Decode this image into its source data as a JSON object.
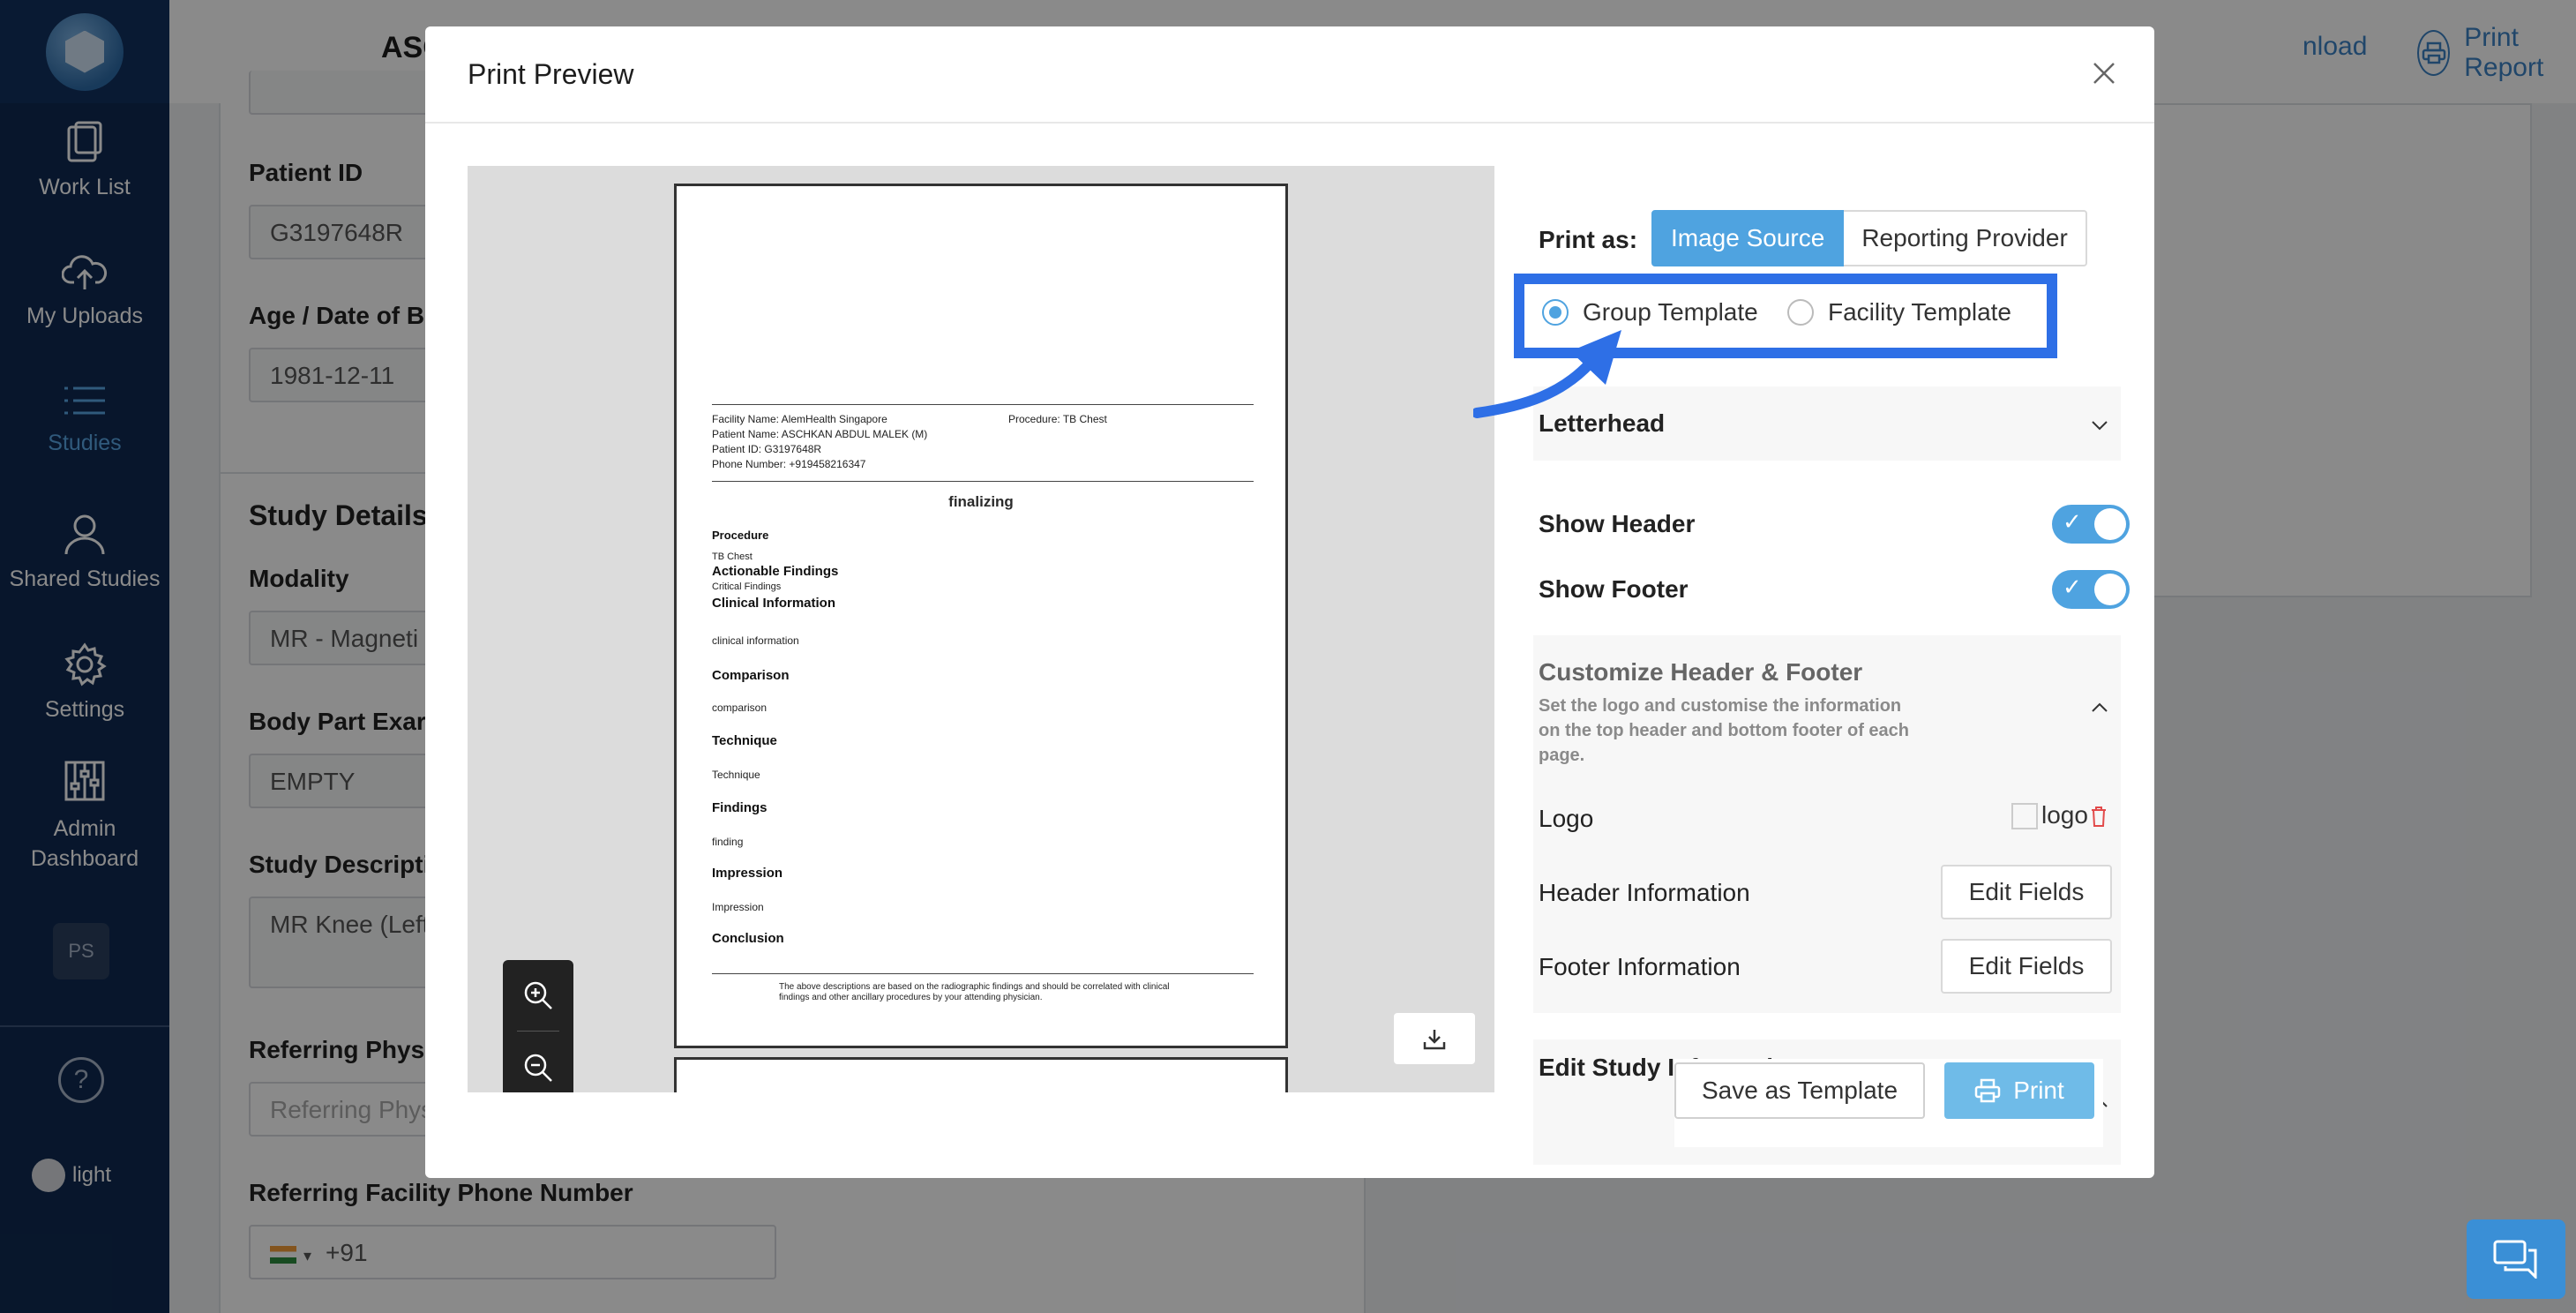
{
  "sidebar": {
    "items": [
      {
        "label": "Work List",
        "icon": "clipboard-icon"
      },
      {
        "label": "My Uploads",
        "icon": "cloud-upload-icon"
      },
      {
        "label": "Studies",
        "icon": "list-icon"
      },
      {
        "label": "Shared Studies",
        "icon": "user-icon"
      },
      {
        "label": "Settings",
        "icon": "gear-icon"
      },
      {
        "label": "Admin Dashboard",
        "icon": "sliders-icon"
      }
    ],
    "user_initials": "PS",
    "theme_label": "light"
  },
  "header": {
    "patient_name": "ASCHKAN ABDU",
    "download_label": "nload",
    "print_report_label": "Print Report"
  },
  "form": {
    "patient_id_label": "Patient ID",
    "patient_id_value": "G3197648R",
    "age_label": "Age / Date of B",
    "age_value": "1981-12-11",
    "study_details_title": "Study Details",
    "modality_label": "Modality",
    "modality_value": "MR - Magneti",
    "body_part_label": "Body Part Exar",
    "body_part_value": "EMPTY",
    "study_desc_label": "Study Descripti",
    "study_desc_value": "MR Knee (Left",
    "referring_phys_label": "Referring Physi",
    "referring_phys_placeholder": "Referring Phys",
    "ref_facility_phone_label": "Referring Facility Phone Number",
    "phone_code": "+91"
  },
  "modal": {
    "title": "Print Preview",
    "preview": {
      "facility_name": "Facility Name: AlemHealth Singapore",
      "procedure_meta": "Procedure: TB Chest",
      "patient_name": "Patient Name: ASCHKAN ABDUL MALEK (M)",
      "patient_id": "Patient ID: G3197648R",
      "phone": "Phone Number: +919458216347",
      "doc_title": "finalizing",
      "procedure_heading": "Procedure",
      "procedure_text": "TB Chest",
      "actionable_heading": "Actionable Findings",
      "actionable_text": "Critical Findings",
      "clinical_heading": "Clinical Information",
      "clinical_text": "clinical information",
      "comparison_heading": "Comparison",
      "comparison_text": "comparison",
      "technique_heading": "Technique",
      "technique_text": "Technique",
      "findings_heading": "Findings",
      "findings_text": "finding",
      "impression_heading": "Impression",
      "impression_text": "Impression",
      "conclusion_heading": "Conclusion",
      "footer_text": "The above descriptions are based on the radiographic findings and should be correlated with clinical findings and other ancillary procedures by your attending physician."
    },
    "settings": {
      "print_as_label": "Print as:",
      "print_as_options": [
        "Image Source",
        "Reporting Provider"
      ],
      "print_as_selected": "Image Source",
      "template_options": [
        "Group Template",
        "Facility Template"
      ],
      "template_selected": "Group Template",
      "letterhead_label": "Letterhead",
      "show_header_label": "Show Header",
      "show_header": true,
      "show_footer_label": "Show Footer",
      "show_footer": true,
      "customize_title": "Customize Header & Footer",
      "customize_desc": "Set the logo and customise the information on the top header and bottom footer of each page.",
      "logo_label": "Logo",
      "logo_alt": "logo",
      "header_info_label": "Header Information",
      "footer_info_label": "Footer Information",
      "edit_fields_label": "Edit Fields",
      "edit_study_label": "Edit Study Information"
    },
    "save_template_label": "Save as Template",
    "print_label": "Print"
  },
  "colors": {
    "sidebar_bg": "#0f2a52",
    "accent": "#4fa3e0",
    "highlight": "#2e6fe6"
  }
}
